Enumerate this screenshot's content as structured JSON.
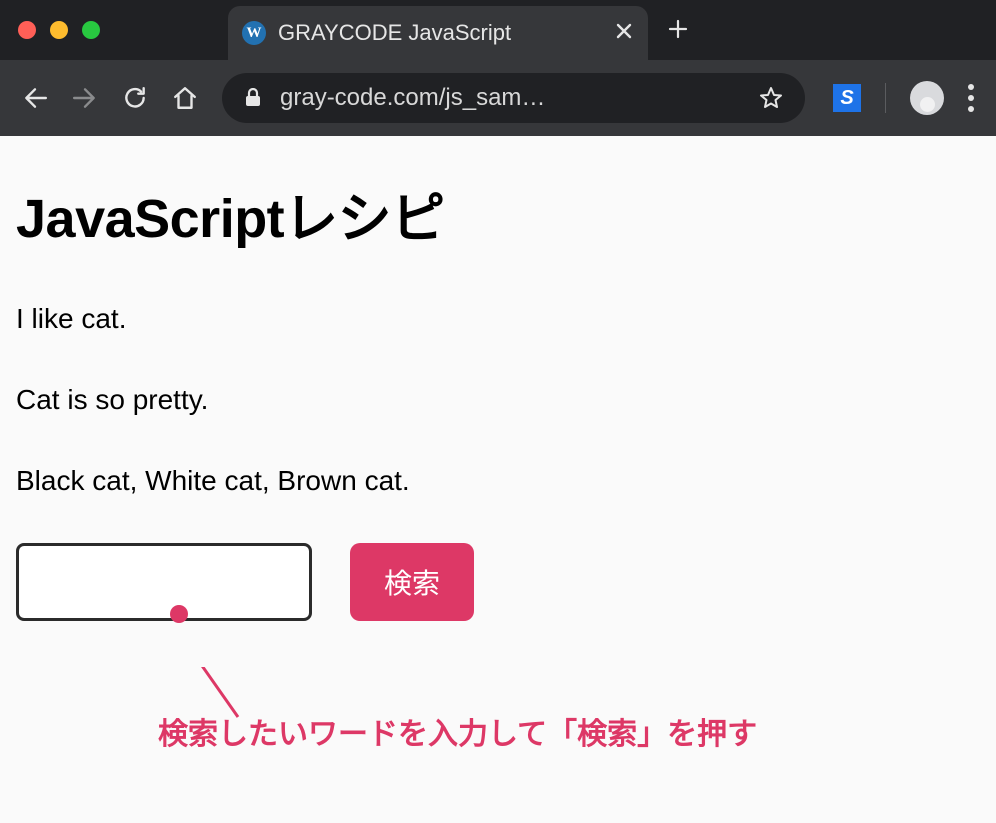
{
  "window": {
    "tab_title": "GRAYCODE JavaScript",
    "favicon_letter": "W",
    "url": "gray-code.com/js_sam…"
  },
  "toolbar": {
    "extension_letter": "S"
  },
  "page": {
    "heading": "JavaScriptレシピ",
    "paragraphs": [
      "I like cat.",
      "Cat is so pretty.",
      "Black cat, White cat, Brown cat."
    ],
    "search": {
      "value": "",
      "button_label": "検索"
    },
    "annotation": "検索したいワードを入力して「検索」を押す"
  }
}
